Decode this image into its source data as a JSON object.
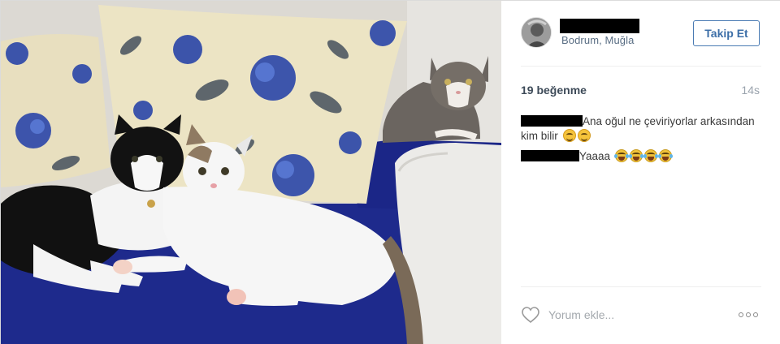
{
  "post": {
    "photo_alt": "",
    "user": {
      "location": "Bodrum, Muğla"
    },
    "follow_label": "Takip Et",
    "likes_text": "19 beğenme",
    "time_text": "14s",
    "comments": [
      {
        "text": "Ana oğul ne çeviriyorlar arkasından kim bilir",
        "emojis": [
          "smile",
          "smile"
        ]
      },
      {
        "text": "Yaaaa",
        "emojis": [
          "laugh-tears",
          "laugh-tears",
          "laugh-tears",
          "laugh-tears"
        ]
      }
    ],
    "comment_placeholder": "Yorum ekle...",
    "icons": {
      "like": "heart-outline-icon",
      "more": "more-dots-icon"
    },
    "colors": {
      "follow_accent": "#3d6fa8",
      "location": "#5a6e84",
      "sofa_blue": "#1e2a8c"
    }
  }
}
